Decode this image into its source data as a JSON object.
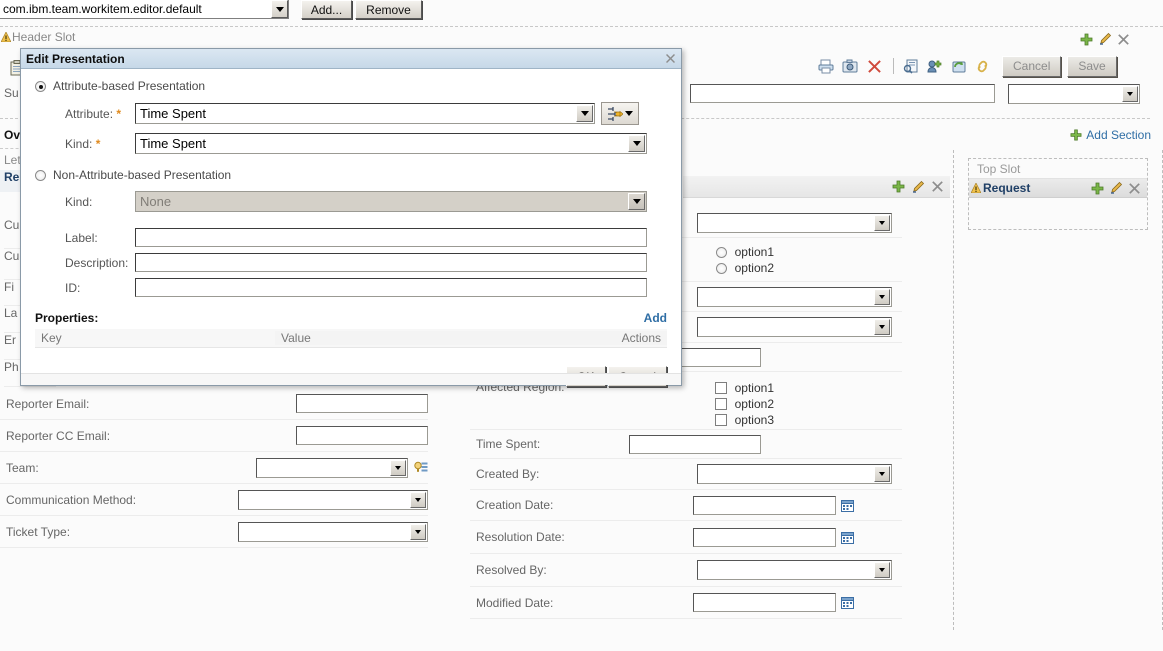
{
  "topbar": {
    "editor_id": "com.ibm.team.workitem.editor.default",
    "add_label": "Add...",
    "remove_label": "Remove"
  },
  "header_slot": {
    "label": "Header Slot"
  },
  "toolbar": {
    "icons": [
      "print-icon",
      "camera-icon",
      "delete-icon",
      "preview-icon",
      "add-user-icon",
      "refresh-icon",
      "link-icon"
    ],
    "cancel_label": "Cancel",
    "save_label": "Save"
  },
  "add_section": {
    "label": "Add Section"
  },
  "left_column": {
    "tabs": [
      "Ov",
      "Let",
      "Re"
    ],
    "summary_label": "Su",
    "hidden_labels": [
      "Cu",
      "Cu",
      "Fi",
      "La",
      "Er",
      "Ph"
    ],
    "rows": [
      {
        "label": "Reporter Email:",
        "type": "text"
      },
      {
        "label": "Reporter CC Email:",
        "type": "text"
      },
      {
        "label": "Team:",
        "type": "select-with-picker"
      },
      {
        "label": "Communication Method:",
        "type": "select"
      },
      {
        "label": "Ticket Type:",
        "type": "select"
      }
    ]
  },
  "mid_column": {
    "rows": [
      {
        "label": "",
        "type": "select"
      },
      {
        "label": "",
        "type": "radio-group",
        "options": [
          "option1",
          "option2"
        ]
      },
      {
        "label": "",
        "type": "select"
      },
      {
        "label": "",
        "type": "select"
      },
      {
        "label": "",
        "type": "text-short"
      },
      {
        "label": "Affected Region:",
        "type": "checkbox-group",
        "options": [
          "option1",
          "option2",
          "option3"
        ]
      },
      {
        "label": "Time Spent:",
        "type": "text-short"
      },
      {
        "label": "Created By:",
        "type": "select"
      },
      {
        "label": "Creation Date:",
        "type": "date"
      },
      {
        "label": "Resolution Date:",
        "type": "date"
      },
      {
        "label": "Resolved By:",
        "type": "select"
      },
      {
        "label": "Modified Date:",
        "type": "date"
      }
    ]
  },
  "right_column": {
    "top_slot_label": "Top Slot",
    "slot_rows": [
      {
        "name": "Request"
      }
    ]
  },
  "dialog": {
    "title": "Edit Presentation",
    "attribute_based": {
      "radio_label": "Attribute-based Presentation",
      "selected": true,
      "attribute_label": "Attribute:",
      "attribute_required": "*",
      "attribute_value": "Time Spent",
      "kind_label": "Kind:",
      "kind_required": "*",
      "kind_value": "Time Spent"
    },
    "non_attribute_based": {
      "radio_label": "Non-Attribute-based Presentation",
      "selected": false,
      "kind_label": "Kind:",
      "kind_value": "None"
    },
    "fields": {
      "label_label": "Label:",
      "label_value": "",
      "description_label": "Description:",
      "description_value": "",
      "id_label": "ID:",
      "id_value": ""
    },
    "properties": {
      "title": "Properties:",
      "add_label": "Add",
      "columns": [
        "Key",
        "Value",
        "Actions"
      ],
      "rows": []
    },
    "ok_label": "OK",
    "cancel_label": "Cancel"
  },
  "colors": {
    "dialog_title_bg": "#cfe0ee",
    "link_blue": "#2f6ea5",
    "required_orange": "#e08a1e",
    "slot_name_blue": "#1f3f66",
    "add_green": "#78b53e"
  }
}
